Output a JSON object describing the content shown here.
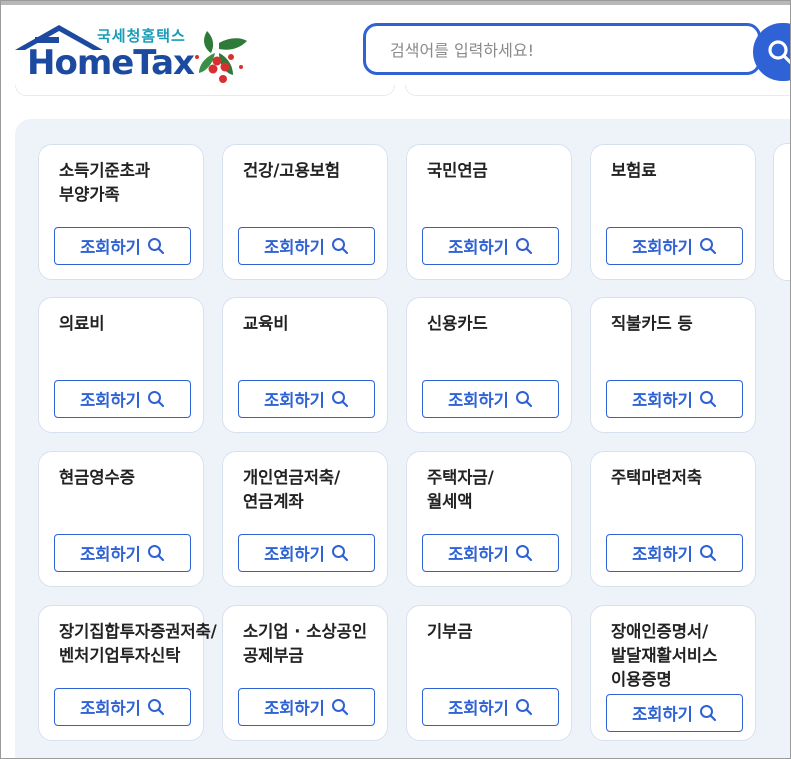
{
  "header": {
    "logo_sub": "국세청홈택스",
    "logo_main": "HomeTax"
  },
  "search": {
    "placeholder": "검색어를 입력하세요!"
  },
  "cards": [
    {
      "title_lines": [
        "소득기준초과",
        "부양가족"
      ],
      "button": "조회하기"
    },
    {
      "title_lines": [
        "건강/고용보험"
      ],
      "button": "조회하기"
    },
    {
      "title_lines": [
        "국민연금"
      ],
      "button": "조회하기"
    },
    {
      "title_lines": [
        "보험료"
      ],
      "button": "조회하기"
    },
    {
      "title_lines": [
        "의료비"
      ],
      "button": "조회하기"
    },
    {
      "title_lines": [
        "교육비"
      ],
      "button": "조회하기"
    },
    {
      "title_lines": [
        "신용카드"
      ],
      "button": "조회하기"
    },
    {
      "title_lines": [
        "직불카드 등"
      ],
      "button": "조회하기"
    },
    {
      "title_lines": [
        "현금영수증"
      ],
      "button": "조회하기"
    },
    {
      "title_lines": [
        "개인연금저축/",
        "연금계좌"
      ],
      "button": "조회하기"
    },
    {
      "title_lines": [
        "주택자금/",
        "월세액"
      ],
      "button": "조회하기"
    },
    {
      "title_lines": [
        "주택마련저축"
      ],
      "button": "조회하기"
    },
    {
      "title_lines": [
        "장기집합투자증권저축/",
        "벤처기업투자신탁"
      ],
      "button": "조회하기"
    },
    {
      "title_lines": [
        "소기업 · 소상공인",
        "공제부금"
      ],
      "button": "조회하기"
    },
    {
      "title_lines": [
        "기부금"
      ],
      "button": "조회하기"
    },
    {
      "title_lines": [
        "장애인증명서/",
        "발달재활서비스",
        "이용증명"
      ],
      "button": "조회하기"
    }
  ],
  "colors": {
    "accent": "#2f62d4",
    "logo_blue": "#1b4aa0",
    "logo_teal": "#1a9cb8",
    "panel_bg": "#eef3fa"
  },
  "icons": {
    "search_button": "search-icon",
    "card_button": "magnifier-icon",
    "logo_decoration": "holly-icon"
  }
}
